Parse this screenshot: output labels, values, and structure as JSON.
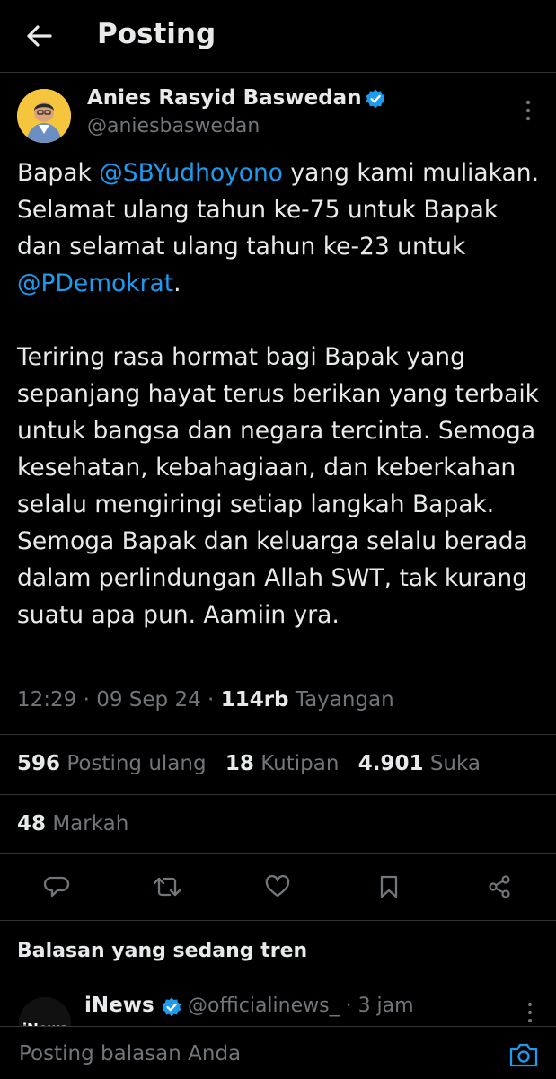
{
  "header": {
    "title": "Posting"
  },
  "author": {
    "name": "Anies Rasyid Baswedan",
    "handle": "@aniesbaswedan"
  },
  "tweet": {
    "p1": {
      "t1": "Bapak ",
      "m1": "@SBYudhoyono",
      "t2": " yang kami muliakan. Selamat ulang tahun ke-75 untuk Bapak dan selamat ulang tahun ke-23 untuk ",
      "m2": "@PDemokrat",
      "t3": "."
    },
    "p2": "Teriring rasa hormat bagi Bapak yang sepanjang hayat terus berikan yang terbaik untuk bangsa dan negara tercinta. Semoga kesehatan, kebahagiaan, dan keberkahan selalu mengiringi setiap langkah Bapak. Semoga Bapak dan keluarga selalu berada dalam perlindungan Allah SWT, tak kurang suatu apa pun. Aamiin yra."
  },
  "meta": {
    "time": "12:29",
    "date": "09 Sep 24",
    "views_count": "114rb",
    "views_label": "Tayangan"
  },
  "stats": {
    "reposts": {
      "count": "596",
      "label": "Posting ulang"
    },
    "quotes": {
      "count": "18",
      "label": "Kutipan"
    },
    "likes": {
      "count": "4.901",
      "label": "Suka"
    },
    "bookmarks": {
      "count": "48",
      "label": "Markah"
    }
  },
  "actions": [
    "reply-icon",
    "retweet-icon",
    "like-icon",
    "bookmark-icon",
    "share-icon"
  ],
  "trending": {
    "title": "Balasan yang sedang tren",
    "reply": {
      "name": "iNews",
      "handle": "@officialinews_",
      "time": "3 jam",
      "avatar_text": "iNews"
    }
  },
  "composer": {
    "placeholder": "Posting balasan Anda"
  },
  "colors": {
    "background": "#000000",
    "text": "#e7e9ea",
    "muted": "#71767b",
    "accent": "#1d9bf0",
    "divider": "#2f3336"
  }
}
